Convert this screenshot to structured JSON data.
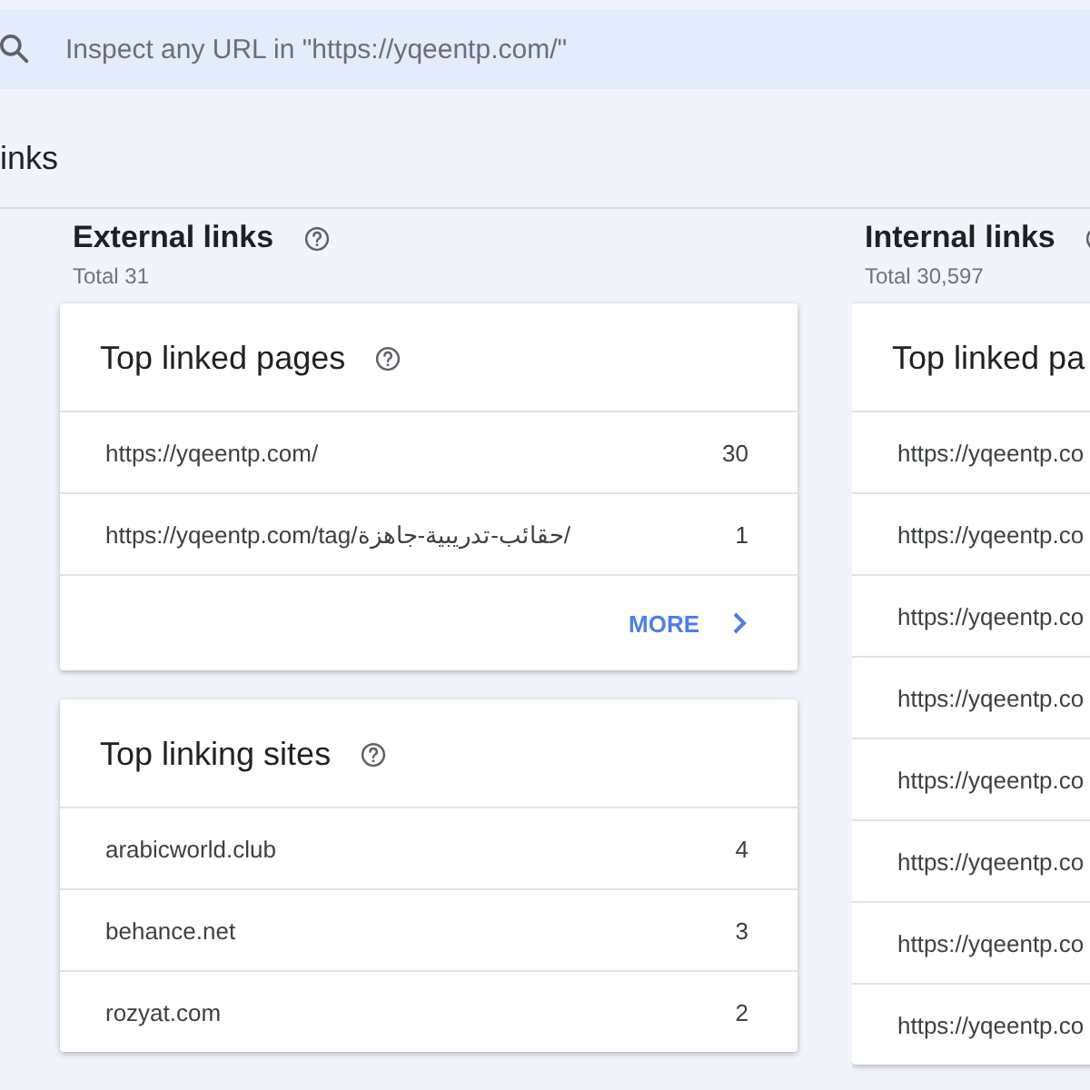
{
  "search": {
    "placeholder": "Inspect any URL in \"https://yqeentp.com/\""
  },
  "page_title": "inks",
  "columns": [
    {
      "title": "External links",
      "total": "Total 31",
      "cards": [
        {
          "title": "Top linked pages",
          "more": "MORE",
          "rows": [
            {
              "label": "https://yqeentp.com/",
              "count": "30"
            },
            {
              "label": "https://yqeentp.com/tag/حقائب-تدريبية-جاهزة/",
              "count": "1"
            }
          ]
        },
        {
          "title": "Top linking sites",
          "rows": [
            {
              "label": "arabicworld.club",
              "count": "4"
            },
            {
              "label": "behance.net",
              "count": "3"
            },
            {
              "label": "rozyat.com",
              "count": "2"
            }
          ]
        }
      ]
    },
    {
      "title": "Internal links",
      "total": "Total 30,597",
      "cards": [
        {
          "title": "Top linked pa",
          "rows": [
            {
              "label": "https://yqeentp.co"
            },
            {
              "label": "https://yqeentp.co"
            },
            {
              "label": "https://yqeentp.co"
            },
            {
              "label": "https://yqeentp.co"
            },
            {
              "label": "https://yqeentp.co"
            },
            {
              "label": "https://yqeentp.co"
            },
            {
              "label": "https://yqeentp.co"
            },
            {
              "label": "https://yqeentp.co"
            }
          ]
        }
      ]
    }
  ]
}
